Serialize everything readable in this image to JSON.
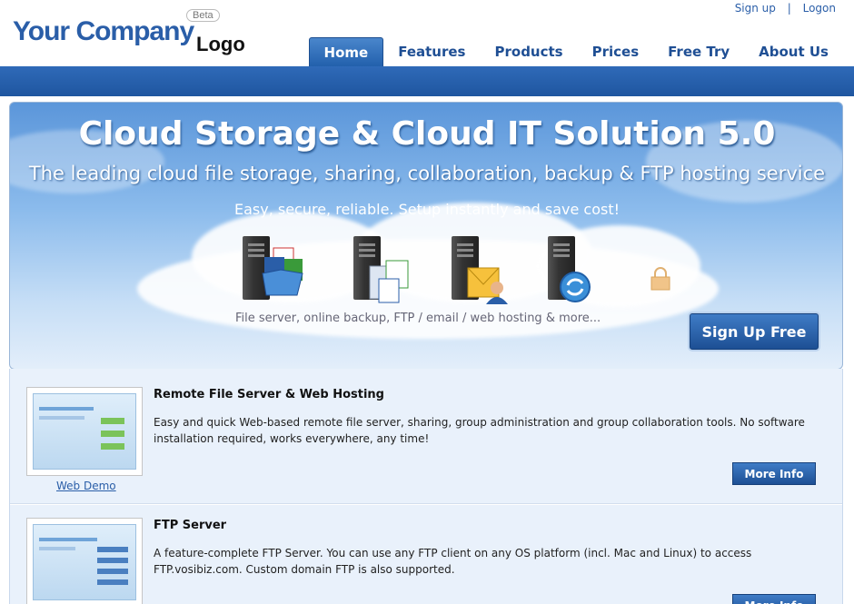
{
  "logo": {
    "main": "Your Company",
    "sub": "Logo",
    "badge": "Beta"
  },
  "toplinks": {
    "signup": "Sign up",
    "separator": "|",
    "logon": "Logon"
  },
  "nav": {
    "items": [
      {
        "label": "Home",
        "active": true
      },
      {
        "label": "Features"
      },
      {
        "label": "Products"
      },
      {
        "label": "Prices"
      },
      {
        "label": "Free Try"
      },
      {
        "label": "About Us"
      }
    ]
  },
  "hero": {
    "title": "Cloud Storage & Cloud IT Solution 5.0",
    "subtitle": "The leading cloud file storage, sharing, collaboration, backup & FTP hosting service",
    "tagline": "Easy, secure, reliable. Setup instantly and save cost!",
    "caption": "File server, online backup, FTP / email / web hosting & more...",
    "signup_label": "Sign Up Free"
  },
  "products": [
    {
      "title": "Remote File Server & Web Hosting",
      "description": "Easy and quick Web-based remote file server, sharing, group administration and group collaboration tools. No software installation required, works everywhere, any time!",
      "demo_label": "Web Demo",
      "more_label": "More Info"
    },
    {
      "title": "FTP Server",
      "description": "A feature-complete FTP Server. You can use any FTP client on any OS platform (incl. Mac and Linux) to access FTP.vosibiz.com. Custom domain FTP is also supported.",
      "more_label": "More Info"
    }
  ],
  "colors": {
    "brand": "#2a5ea8",
    "nav_bar": "#1f56a0",
    "content_bg": "#e9f1fb"
  }
}
